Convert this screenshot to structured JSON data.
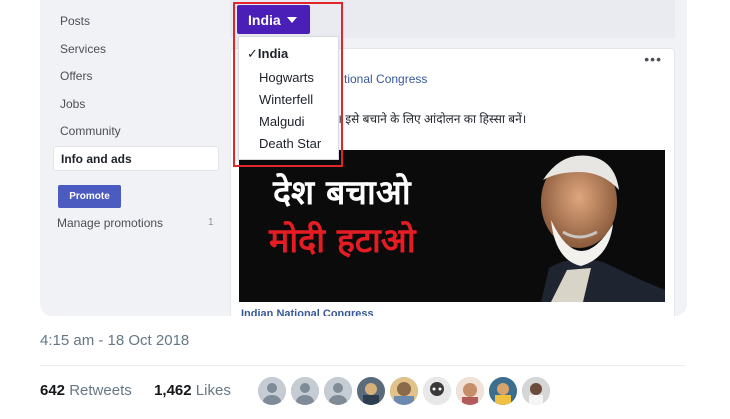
{
  "sidebar": {
    "items": [
      {
        "label": "Posts"
      },
      {
        "label": "Services"
      },
      {
        "label": "Offers"
      },
      {
        "label": "Jobs"
      },
      {
        "label": "Community"
      }
    ],
    "active_label": "Info and ads",
    "promote_label": "Promote",
    "manage_label": "Manage promotions",
    "manage_count": "1"
  },
  "dropdown": {
    "selected": "India",
    "options": [
      {
        "label": "India",
        "checked": true
      },
      {
        "label": "Hogwarts"
      },
      {
        "label": "Winterfell"
      },
      {
        "label": "Malgudi"
      },
      {
        "label": "Death Star"
      }
    ]
  },
  "post": {
    "more_label": "•••",
    "page_name_visible": "tional Congress",
    "text_visible": "है। इसे बचाने के लिए आंदोलन का हिस्सा बनें।",
    "image_line1": "देश बचाओ",
    "image_line2": "मोदी हटाओ",
    "footer_link": "Indian National Congress"
  },
  "tweet": {
    "timestamp": "4:15 am - 18 Oct 2018",
    "retweets_count": "642",
    "retweets_label": "Retweets",
    "likes_count": "1,462",
    "likes_label": "Likes",
    "avatars": [
      "default",
      "default",
      "default",
      "photo",
      "photo",
      "photo",
      "photo",
      "photo",
      "photo"
    ]
  },
  "colors": {
    "dropdown_bg": "#4a1fb8",
    "highlight_border": "#e0262b",
    "promote_bg": "#4b5bbf",
    "link": "#365899",
    "meta_text": "#657786"
  }
}
